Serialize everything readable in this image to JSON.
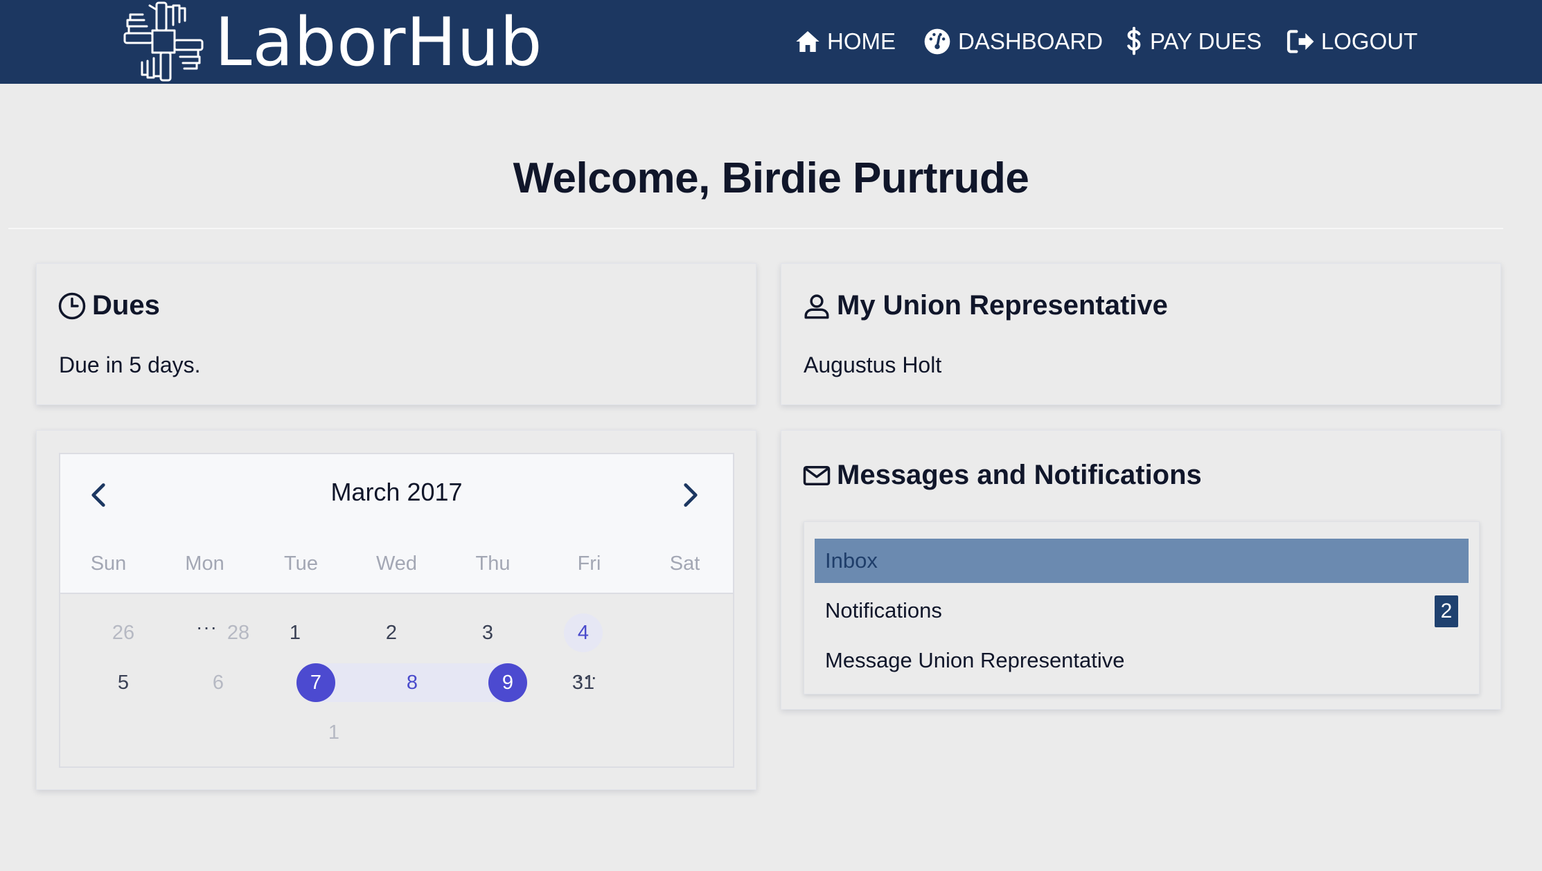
{
  "app": {
    "brand": "LaborHub"
  },
  "nav": {
    "home": "HOME",
    "dashboard": "DASHBOARD",
    "pay_dues": "PAY DUES",
    "logout": "LOGOUT"
  },
  "page": {
    "welcome": "Welcome, Birdie Purtrude"
  },
  "dues": {
    "title": "Dues",
    "text": "Due in 5 days."
  },
  "rep": {
    "title": "My Union Representative",
    "name": "Augustus Holt"
  },
  "calendar": {
    "title": "March 2017",
    "weekdays": [
      "Sun",
      "Mon",
      "Tue",
      "Wed",
      "Thu",
      "Fri",
      "Sat"
    ],
    "days": {
      "d26": "26",
      "d28": "28",
      "d1": "1",
      "d2": "2",
      "d3": "3",
      "d4": "4",
      "d5": "5",
      "d6": "6",
      "d7": "7",
      "d8": "8",
      "d9": "9",
      "d31": "31",
      "dnext1": "1"
    },
    "ellipsis": "···"
  },
  "messages": {
    "title": "Messages and Notifications",
    "items": [
      "Inbox",
      "Notifications",
      "Message Union Representative"
    ],
    "notifications_count": "2"
  },
  "colors": {
    "navbar": "#1c3761",
    "selected_day": "#4c4ad0",
    "active_item": "#6b8ab0",
    "badge": "#1f416f"
  }
}
